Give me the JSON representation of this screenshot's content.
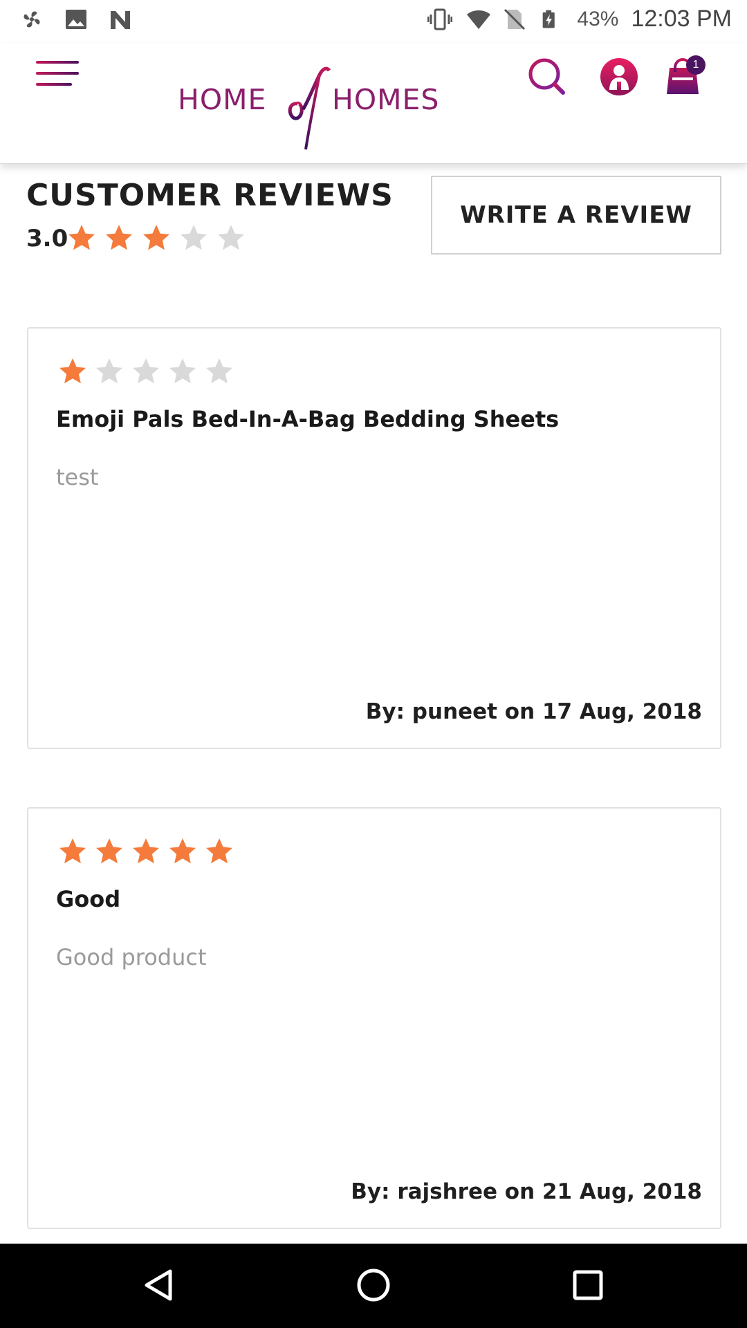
{
  "status_bar": {
    "battery": "43%",
    "time": "12:03 PM",
    "icons": [
      "fan-icon",
      "image-icon",
      "n-logo-icon",
      "vibrate-icon",
      "wifi-icon",
      "no-sim-icon",
      "battery-charging-icon"
    ]
  },
  "header": {
    "logo_left": "HOME",
    "logo_right": "HOMES",
    "logo_mark": "of",
    "cart_count": "1",
    "brand_color": "#8a1f6b",
    "accent_color": "#c2185b"
  },
  "reviews": {
    "title": "CUSTOMER REVIEWS",
    "average_rating": "3.0",
    "average_stars": 3,
    "write_button": "WRITE A REVIEW"
  },
  "cards": [
    {
      "stars": 1,
      "title": "Emoji Pals Bed-In-A-Bag Bedding Sheets",
      "body": "test",
      "byline": "By: puneet on 17 Aug, 2018"
    },
    {
      "stars": 5,
      "title": "Good",
      "body": "Good product",
      "byline": "By: rajshree on 21 Aug, 2018"
    }
  ],
  "colors": {
    "star_filled": "#f47b3b",
    "star_empty": "#d9d9d9"
  }
}
